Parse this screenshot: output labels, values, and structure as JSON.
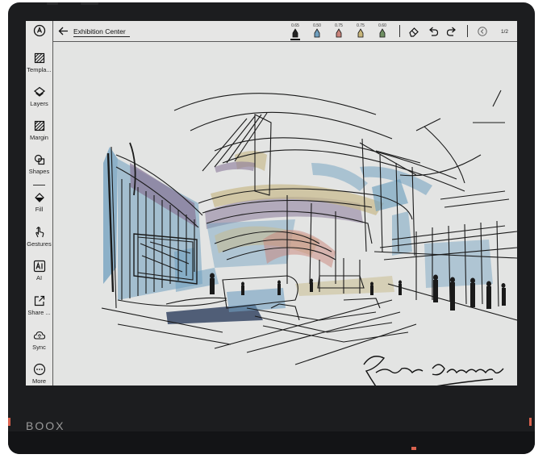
{
  "device": {
    "brand": "BOOX"
  },
  "header": {
    "title": "Exhibition Center",
    "page_indicator": "1/2",
    "pens": [
      {
        "value": "0.65",
        "color": "#222222"
      },
      {
        "value": "0.50",
        "color": "#6f9fbf"
      },
      {
        "value": "0.75",
        "color": "#c9837a"
      },
      {
        "value": "0.75",
        "color": "#c7b57a"
      },
      {
        "value": "0.60",
        "color": "#6f8f62"
      }
    ]
  },
  "sidebar": {
    "items": [
      {
        "label": "Templa...",
        "icon": "template-icon"
      },
      {
        "label": "Layers",
        "icon": "layers-icon"
      },
      {
        "label": "Margin",
        "icon": "margin-icon"
      },
      {
        "label": "Shapes",
        "icon": "shapes-icon"
      },
      {
        "label": "Fill",
        "icon": "fill-icon"
      },
      {
        "label": "Gestures",
        "icon": "gestures-icon"
      },
      {
        "label": "AI",
        "icon": "ai-icon"
      },
      {
        "label": "Share ...",
        "icon": "share-icon"
      },
      {
        "label": "Sync",
        "icon": "sync-icon"
      },
      {
        "label": "More",
        "icon": "more-icon"
      }
    ]
  },
  "colors": {
    "screen": "#e3e4e3",
    "bezel": "#1c1d1f",
    "accent": "#d9624e",
    "sketch_blue": "#6f9fbf",
    "sketch_purple": "#8a7a9a",
    "sketch_sand": "#c7b98a",
    "sketch_navy": "#3f4f6a"
  }
}
